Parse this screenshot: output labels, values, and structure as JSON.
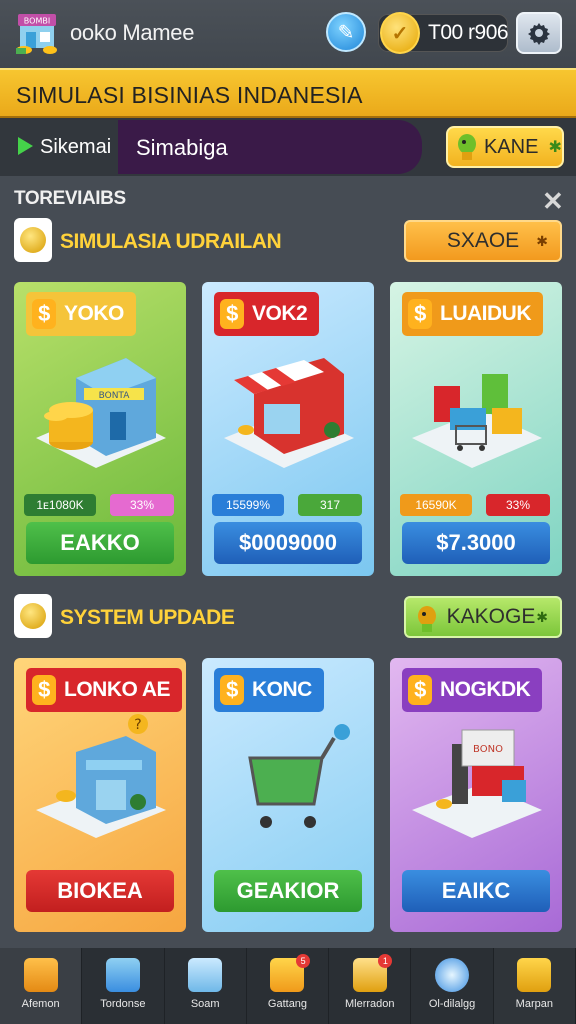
{
  "header": {
    "logo_text": "BOMBI",
    "app_title": "ooko Mamee",
    "coin_value": "T00 r906",
    "icons": {
      "chat": "chat-bubble-icon",
      "coin": "gold-coin-icon",
      "settings": "settings-gear-icon"
    }
  },
  "banner": {
    "title": "SIMULASI BISINIAS INDANESIA"
  },
  "nav": {
    "play_label": "Sikemai",
    "active_label": "Simabiga",
    "kane_button": "KANE"
  },
  "panel": {
    "header": "TOREVIAIBS",
    "section1": {
      "title": "SIMULASIA UDRAILAN",
      "button": "SXAOE",
      "cards": [
        {
          "label": "YOKO",
          "stat": "1ᴇ1080K",
          "pct": "33%",
          "action": "EAKKO",
          "building_sign": "BONTA"
        },
        {
          "label": "VOK2",
          "stat": "15599%",
          "pct": "317",
          "action": "$0009000"
        },
        {
          "label": "LUAIDUK",
          "stat": "16590K",
          "pct": "33%",
          "action": "$7.3000"
        }
      ]
    },
    "section2": {
      "title": "SYSTEM UPDADE",
      "button": "KAKOGE",
      "cards": [
        {
          "label": "LONKO AE",
          "action": "BIOKEA"
        },
        {
          "label": "KONC",
          "action": "GEAKIOR"
        },
        {
          "label": "NOGKDK",
          "action": "EAIKC",
          "box_sign": "BONO"
        }
      ]
    }
  },
  "tabs": [
    {
      "label": "Afemon",
      "icon": "basket-icon"
    },
    {
      "label": "Tordonse",
      "icon": "calendar-icon"
    },
    {
      "label": "Soam",
      "icon": "box-icon"
    },
    {
      "label": "Gattang",
      "icon": "bag-icon",
      "badge": "5"
    },
    {
      "label": "Mlerradon",
      "icon": "map-icon",
      "badge": "1"
    },
    {
      "label": "Ol-dilalgg",
      "icon": "globe-icon"
    },
    {
      "label": "Marpan",
      "icon": "robot-icon"
    }
  ],
  "colors": {
    "banner": "#f2b320",
    "accent_gold": "#ffd23a",
    "panel": "#464c54"
  }
}
